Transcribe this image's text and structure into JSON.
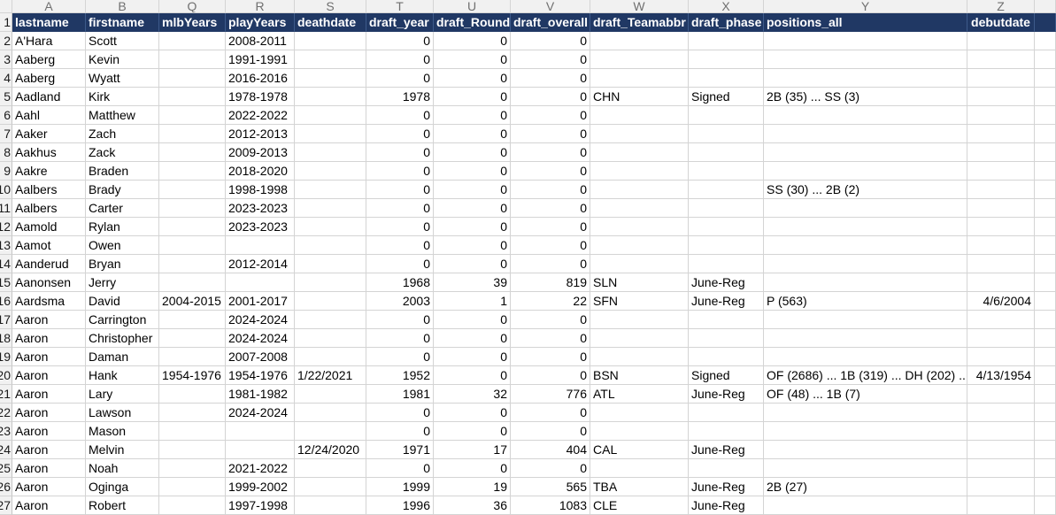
{
  "columns": [
    {
      "letter": "A",
      "name": "lastname",
      "align": "left"
    },
    {
      "letter": "B",
      "name": "firstname",
      "align": "left"
    },
    {
      "letter": "Q",
      "name": "mlbYears",
      "align": "left"
    },
    {
      "letter": "R",
      "name": "playYears",
      "align": "left"
    },
    {
      "letter": "S",
      "name": "deathdate",
      "align": "left"
    },
    {
      "letter": "T",
      "name": "draft_year",
      "align": "right"
    },
    {
      "letter": "U",
      "name": "draft_Round",
      "align": "right"
    },
    {
      "letter": "V",
      "name": "draft_overall",
      "align": "right"
    },
    {
      "letter": "W",
      "name": "draft_Teamabbr",
      "align": "left"
    },
    {
      "letter": "X",
      "name": "draft_phase",
      "align": "left"
    },
    {
      "letter": "Y",
      "name": "positions_all",
      "align": "left"
    },
    {
      "letter": "Z",
      "name": "debutdate",
      "align": "center"
    }
  ],
  "rows": [
    {
      "num": "2",
      "cells": [
        "A'Hara",
        "Scott",
        "",
        "2008-2011",
        "",
        "0",
        "0",
        "0",
        "",
        "",
        "",
        ""
      ]
    },
    {
      "num": "3",
      "cells": [
        "Aaberg",
        "Kevin",
        "",
        "1991-1991",
        "",
        "0",
        "0",
        "0",
        "",
        "",
        "",
        ""
      ]
    },
    {
      "num": "4",
      "cells": [
        "Aaberg",
        "Wyatt",
        "",
        "2016-2016",
        "",
        "0",
        "0",
        "0",
        "",
        "",
        "",
        ""
      ]
    },
    {
      "num": "5",
      "cells": [
        "Aadland",
        "Kirk",
        "",
        "1978-1978",
        "",
        "1978",
        "0",
        "0",
        "CHN",
        "Signed",
        "2B (35) ... SS (3)",
        ""
      ]
    },
    {
      "num": "6",
      "cells": [
        "Aahl",
        "Matthew",
        "",
        "2022-2022",
        "",
        "0",
        "0",
        "0",
        "",
        "",
        "",
        ""
      ]
    },
    {
      "num": "7",
      "cells": [
        "Aaker",
        "Zach",
        "",
        "2012-2013",
        "",
        "0",
        "0",
        "0",
        "",
        "",
        "",
        ""
      ]
    },
    {
      "num": "8",
      "cells": [
        "Aakhus",
        "Zack",
        "",
        "2009-2013",
        "",
        "0",
        "0",
        "0",
        "",
        "",
        "",
        ""
      ]
    },
    {
      "num": "9",
      "cells": [
        "Aakre",
        "Braden",
        "",
        "2018-2020",
        "",
        "0",
        "0",
        "0",
        "",
        "",
        "",
        ""
      ]
    },
    {
      "num": "10",
      "cells": [
        "Aalbers",
        "Brady",
        "",
        "1998-1998",
        "",
        "0",
        "0",
        "0",
        "",
        "",
        "SS (30) ... 2B (2)",
        ""
      ]
    },
    {
      "num": "11",
      "cells": [
        "Aalbers",
        "Carter",
        "",
        "2023-2023",
        "",
        "0",
        "0",
        "0",
        "",
        "",
        "",
        ""
      ]
    },
    {
      "num": "12",
      "cells": [
        "Aamold",
        "Rylan",
        "",
        "2023-2023",
        "",
        "0",
        "0",
        "0",
        "",
        "",
        "",
        ""
      ]
    },
    {
      "num": "13",
      "cells": [
        "Aamot",
        "Owen",
        "",
        "",
        "",
        "0",
        "0",
        "0",
        "",
        "",
        "",
        ""
      ]
    },
    {
      "num": "14",
      "cells": [
        "Aanderud",
        "Bryan",
        "",
        "2012-2014",
        "",
        "0",
        "0",
        "0",
        "",
        "",
        "",
        ""
      ]
    },
    {
      "num": "15",
      "cells": [
        "Aanonsen",
        "Jerry",
        "",
        "",
        "",
        "1968",
        "39",
        "819",
        "SLN",
        "June-Reg",
        "",
        ""
      ]
    },
    {
      "num": "16",
      "cells": [
        "Aardsma",
        "David",
        "2004-2015",
        "2001-2017",
        "",
        "2003",
        "1",
        "22",
        "SFN",
        "June-Reg",
        "P (563)",
        "4/6/2004"
      ]
    },
    {
      "num": "17",
      "cells": [
        "Aaron",
        "Carrington",
        "",
        "2024-2024",
        "",
        "0",
        "0",
        "0",
        "",
        "",
        "",
        ""
      ]
    },
    {
      "num": "18",
      "cells": [
        "Aaron",
        "Christopher",
        "",
        "2024-2024",
        "",
        "0",
        "0",
        "0",
        "",
        "",
        "",
        ""
      ]
    },
    {
      "num": "19",
      "cells": [
        "Aaron",
        "Daman",
        "",
        "2007-2008",
        "",
        "0",
        "0",
        "0",
        "",
        "",
        "",
        ""
      ]
    },
    {
      "num": "20",
      "cells": [
        "Aaron",
        "Hank",
        "1954-1976",
        "1954-1976",
        "1/22/2021",
        "1952",
        "0",
        "0",
        "BSN",
        "Signed",
        "OF (2686) ... 1B (319) ... DH (202) ...",
        "4/13/1954"
      ]
    },
    {
      "num": "21",
      "cells": [
        "Aaron",
        "Lary",
        "",
        "1981-1982",
        "",
        "1981",
        "32",
        "776",
        "ATL",
        "June-Reg",
        "OF (48) ... 1B (7)",
        ""
      ]
    },
    {
      "num": "22",
      "cells": [
        "Aaron",
        "Lawson",
        "",
        "2024-2024",
        "",
        "0",
        "0",
        "0",
        "",
        "",
        "",
        ""
      ]
    },
    {
      "num": "23",
      "cells": [
        "Aaron",
        "Mason",
        "",
        "",
        "",
        "0",
        "0",
        "0",
        "",
        "",
        "",
        ""
      ]
    },
    {
      "num": "24",
      "cells": [
        "Aaron",
        "Melvin",
        "",
        "",
        "12/24/2020",
        "1971",
        "17",
        "404",
        "CAL",
        "June-Reg",
        "",
        ""
      ]
    },
    {
      "num": "25",
      "cells": [
        "Aaron",
        "Noah",
        "",
        "2021-2022",
        "",
        "0",
        "0",
        "0",
        "",
        "",
        "",
        ""
      ]
    },
    {
      "num": "26",
      "cells": [
        "Aaron",
        "Oginga",
        "",
        "1999-2002",
        "",
        "1999",
        "19",
        "565",
        "TBA",
        "June-Reg",
        "2B (27)",
        ""
      ]
    },
    {
      "num": "27",
      "cells": [
        "Aaron",
        "Robert",
        "",
        "1997-1998",
        "",
        "1996",
        "36",
        "1083",
        "CLE",
        "June-Reg",
        "",
        ""
      ]
    }
  ],
  "headerRowNum": "1"
}
